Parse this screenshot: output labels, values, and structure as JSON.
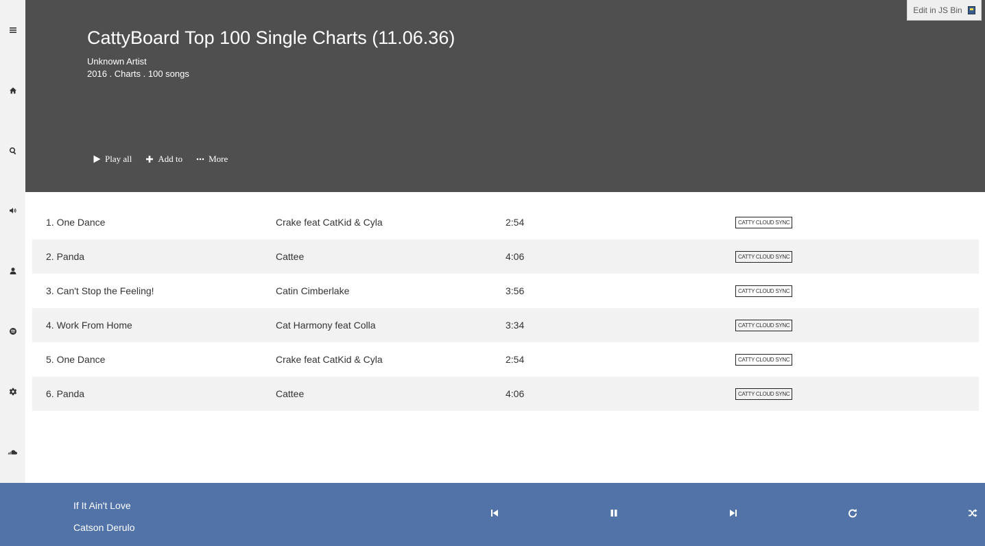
{
  "sidebar": {
    "icons": [
      "menu-icon",
      "home-icon",
      "search-icon",
      "volume-icon",
      "user-icon",
      "spotify-icon",
      "gear-icon",
      "soundcloud-icon"
    ]
  },
  "header": {
    "title": "CattyBoard Top 100 Single Charts (11.06.36)",
    "artist": "Unknown Artist",
    "meta": "2016 . Charts . 100 songs",
    "actions": {
      "play_all": "Play all",
      "add_to": "Add to",
      "more": "More"
    },
    "background": "#4f4f4f"
  },
  "jsbin": {
    "label": "Edit in JS Bin"
  },
  "tracks": [
    {
      "title": "1. One Dance",
      "artist": "Crake feat CatKid & Cyla",
      "duration": "2:54",
      "badge": "CATTY CLOUD SYNC"
    },
    {
      "title": "2. Panda",
      "artist": "Cattee",
      "duration": "4:06",
      "badge": "CATTY CLOUD SYNC"
    },
    {
      "title": "3. Can't Stop the Feeling!",
      "artist": "Catin Cimberlake",
      "duration": "3:56",
      "badge": "CATTY CLOUD SYNC"
    },
    {
      "title": "4. Work From Home",
      "artist": "Cat Harmony feat Colla",
      "duration": "3:34",
      "badge": "CATTY CLOUD SYNC"
    },
    {
      "title": "5. One Dance",
      "artist": "Crake feat CatKid & Cyla",
      "duration": "2:54",
      "badge": "CATTY CLOUD SYNC"
    },
    {
      "title": "6. Panda",
      "artist": "Cattee",
      "duration": "4:06",
      "badge": "CATTY CLOUD SYNC"
    }
  ],
  "player": {
    "song": "If It Ain't Love",
    "artist": "Catson Derulo",
    "background": "#5173a7",
    "controls": [
      "previous-icon",
      "pause-icon",
      "next-icon",
      "repeat-icon",
      "shuffle-icon"
    ]
  }
}
